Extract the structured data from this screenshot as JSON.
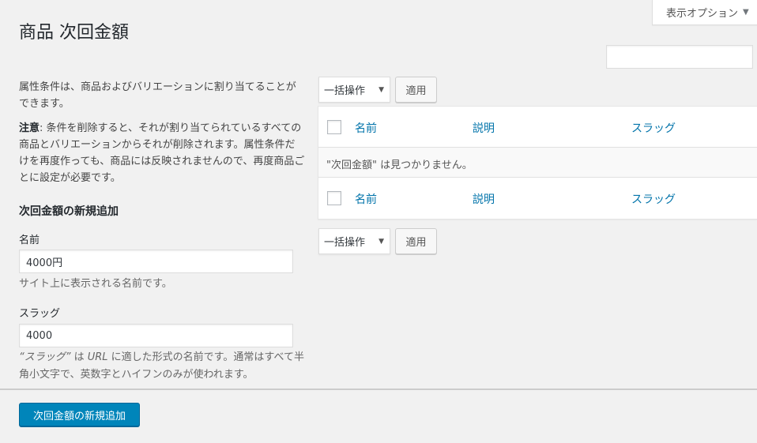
{
  "screen_options": {
    "label": "表示オプション"
  },
  "page": {
    "title": "商品 次回金額"
  },
  "description": {
    "intro": "属性条件は、商品およびバリエーションに割り当てることができます。",
    "note_label": "注意",
    "note_text": ": 条件を削除すると、それが割り当てられているすべての商品とバリエーションからそれが削除されます。属性条件だけを再度作っても、商品には反映されませんので、再度商品ごとに設定が必要です。"
  },
  "form": {
    "title": "次回金額の新規追加",
    "name_label": "名前",
    "name_value": "4000円",
    "name_help": "サイト上に表示される名前です。",
    "slug_label": "スラッグ",
    "slug_value": "4000",
    "slug_help_quote": "“スラッグ”",
    "slug_help_is": " は ",
    "slug_help_url": "URL",
    "slug_help_rest": " に適した形式の名前です。通常はすべて半角小文字で、英数字とハイフンのみが使われます。",
    "submit_label": "次回金額の新規追加"
  },
  "bulk": {
    "top_select": "一括操作",
    "bottom_select": "一括操作",
    "apply_label": "適用"
  },
  "table": {
    "columns": [
      "名前",
      "説明",
      "スラッグ"
    ],
    "empty_message": "\"次回金額\" は見つかりません。"
  },
  "colors": {
    "primary": "#0085ba",
    "link": "#0073aa",
    "background": "#f1f1f1"
  },
  "icons": {
    "dropdown": "caret-down-icon"
  }
}
